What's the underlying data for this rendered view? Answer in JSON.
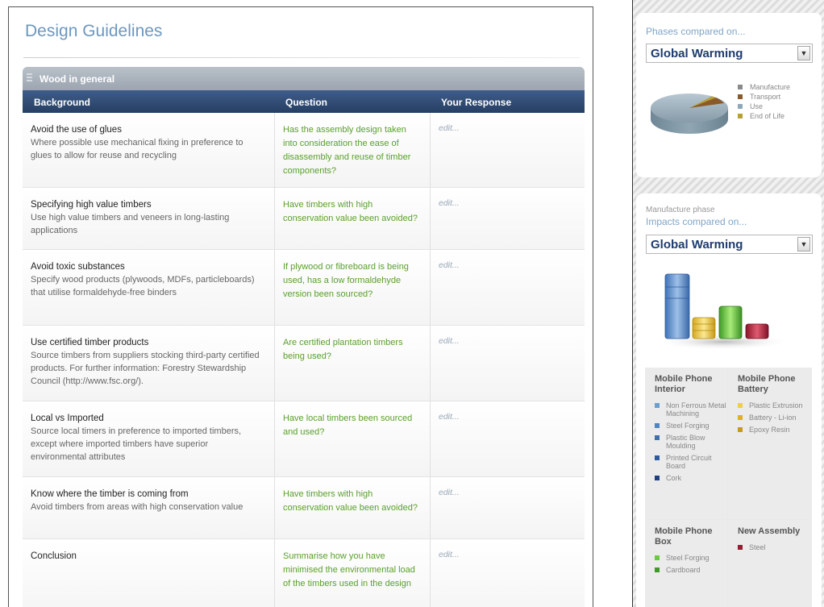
{
  "main": {
    "title": "Design Guidelines",
    "group_label": "Wood in general",
    "columns": [
      "Background",
      "Question",
      "Your Response"
    ],
    "rows": [
      {
        "title": "Avoid the use of glues",
        "desc": "Where possible use mechanical fixing in preference to glues to allow for reuse and recycling",
        "question": "Has the assembly design taken into consideration the ease of disassembly and reuse of timber components?",
        "response": "edit..."
      },
      {
        "title": "Specifying high value timbers",
        "desc": "Use high value timbers and veneers in long-lasting applications",
        "question": "Have timbers with high conservation value been avoided?",
        "response": "edit..."
      },
      {
        "title": "Avoid toxic substances",
        "desc": "Specify wood products (plywoods, MDFs, particleboards) that utilise formaldehyde-free binders",
        "question": "If plywood or fibreboard is being used, has a low formaldehyde version been sourced?",
        "response": "edit..."
      },
      {
        "title": "Use certified timber products",
        "desc": "Source timbers from suppliers stocking third-party certified products. For further information: Forestry Stewardship Council (http://www.fsc.org/).",
        "question": "Are certified plantation timbers being used?",
        "response": "edit..."
      },
      {
        "title": "Local vs Imported",
        "desc": "Source local timers in preference to imported timbers, except where imported timbers have superior environmental attributes",
        "question": "Have local timbers been sourced and used?",
        "response": "edit..."
      },
      {
        "title": "Know where the timber is coming from",
        "desc": "Avoid timbers from areas with high conservation value",
        "question": "Have timbers with high conservation value been avoided?",
        "response": "edit..."
      },
      {
        "title": "Conclusion",
        "desc": "",
        "question": "Summarise how you have minimised the environmental load of the timbers used in the design",
        "response": "edit..."
      }
    ]
  },
  "phases_panel": {
    "label": "Phases compared on...",
    "dropdown_value": "Global Warming",
    "legend": [
      {
        "label": "Manufacture",
        "color": "#8a8a8a"
      },
      {
        "label": "Transport",
        "color": "#8b5a2b"
      },
      {
        "label": "Use",
        "color": "#8fa8b8"
      },
      {
        "label": "End of Life",
        "color": "#b8a030"
      }
    ]
  },
  "impacts_panel": {
    "small_label": "Manufacture phase",
    "label": "Impacts compared on...",
    "dropdown_value": "Global Warming",
    "groups": [
      {
        "title": "Mobile Phone Interior",
        "items": [
          {
            "label": "Non Ferrous Metal Machining",
            "color": "#6a9fd0"
          },
          {
            "label": "Steel Forging",
            "color": "#4f86c0"
          },
          {
            "label": "Plastic Blow Moulding",
            "color": "#3f6fb0"
          },
          {
            "label": "Printed Circuit Board",
            "color": "#2f5aa0"
          },
          {
            "label": "Cork",
            "color": "#1f3f80"
          }
        ]
      },
      {
        "title": "Mobile Phone Battery",
        "items": [
          {
            "label": "Plastic Extrusion",
            "color": "#f0d040"
          },
          {
            "label": "Battery - Li-ion",
            "color": "#e0b020"
          },
          {
            "label": "Epoxy Resin",
            "color": "#c89a18"
          }
        ]
      },
      {
        "title": "Mobile Phone Box",
        "items": [
          {
            "label": "Steel Forging",
            "color": "#6acb3a"
          },
          {
            "label": "Cardboard",
            "color": "#3f9a28"
          }
        ]
      },
      {
        "title": "New Assembly",
        "items": [
          {
            "label": "Steel",
            "color": "#a01830"
          }
        ]
      }
    ]
  }
}
